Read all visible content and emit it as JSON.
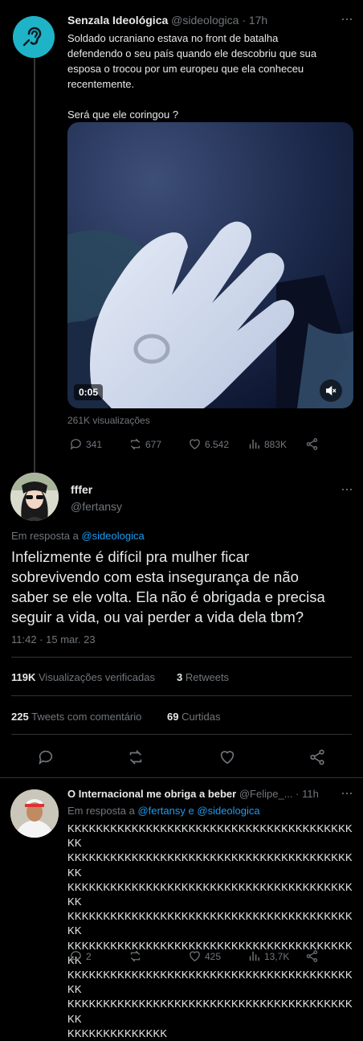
{
  "tweet1": {
    "display_name": "Senzala Ideológica",
    "handle": "@sideologica",
    "time": "· 17h",
    "text_lines": [
      "Soldado ucraniano  estava no front de batalha",
      "defendendo o seu país quando ele descobriu que sua",
      "esposa o trocou por um europeu que ela conheceu",
      "recentemente."
    ],
    "text_question": "Será que ele coringou ?",
    "video_time": "0:05",
    "views": "261K visualizações",
    "replies": "341",
    "retweets": "677",
    "likes": "6.542",
    "analytics": "883K"
  },
  "main_tweet": {
    "display_name": "fffer",
    "handle": "@fertansy",
    "reply_to_prefix": "Em resposta a",
    "reply_to_handle": "@sideologica",
    "text_lines": [
      "Infelizmente é difícil pra mulher ficar",
      "sobrevivendo com esta insegurança de não",
      "saber se ele volta. Ela não é obrigada e precisa",
      "seguir a vida, ou vai perder a vida dela tbm?"
    ],
    "timestamp": "11:42 · 15 mar. 23",
    "views_count": "119K",
    "views_label": "Visualizações verificadas",
    "retweets_count": "3",
    "retweets_label": "Retweets",
    "quote_count": "225",
    "quote_label": "Tweets com comentário",
    "likes_count": "69",
    "likes_label": "Curtidas"
  },
  "reply_tweet": {
    "display_name": "O Internacional me obriga a beber",
    "handle": "@Felipe_...",
    "time": "· 11h",
    "reply_to_prefix": "Em resposta a",
    "reply_to_handle1": "@fertansy",
    "reply_to_and": "e",
    "reply_to_handle2": "@sideologica",
    "kk_lines": [
      "KKKKKKKKKKKKKKKKKKKKKKKKKKKKKKKKKKKKKKKKKK",
      "KKKKKKKKKKKKKKKKKKKKKKKKKKKKKKKKKKKKKKKKKK",
      "KKKKKKKKKKKKKKKKKKKKKKKKKKKKKKKKKKKKKKKKKK",
      "KKKKKKKKKKKKKKKKKKKKKKKKKKKKKKKKKKKKKKKKKK",
      "KKKKKKKKKKKKKKKKKKKKKKKKKKKKKKKKKKKKKKKKKK",
      "KKKKKKKKKKKKKKKKKKKKKKKKKKKKKKKKKKKKKKKKKK",
      "KKKKKKKKKKKKKKKKKKKKKKKKKKKKKKKKKKKKKKKKKK",
      "KKKKKKKKKKKKKK"
    ],
    "replies": "2",
    "likes": "425",
    "analytics": "13,7K"
  },
  "colors": {
    "background": "#000000",
    "text": "#e7e9ea",
    "muted": "#71767b",
    "link": "#1d9bf0",
    "divider": "#2f3336"
  }
}
